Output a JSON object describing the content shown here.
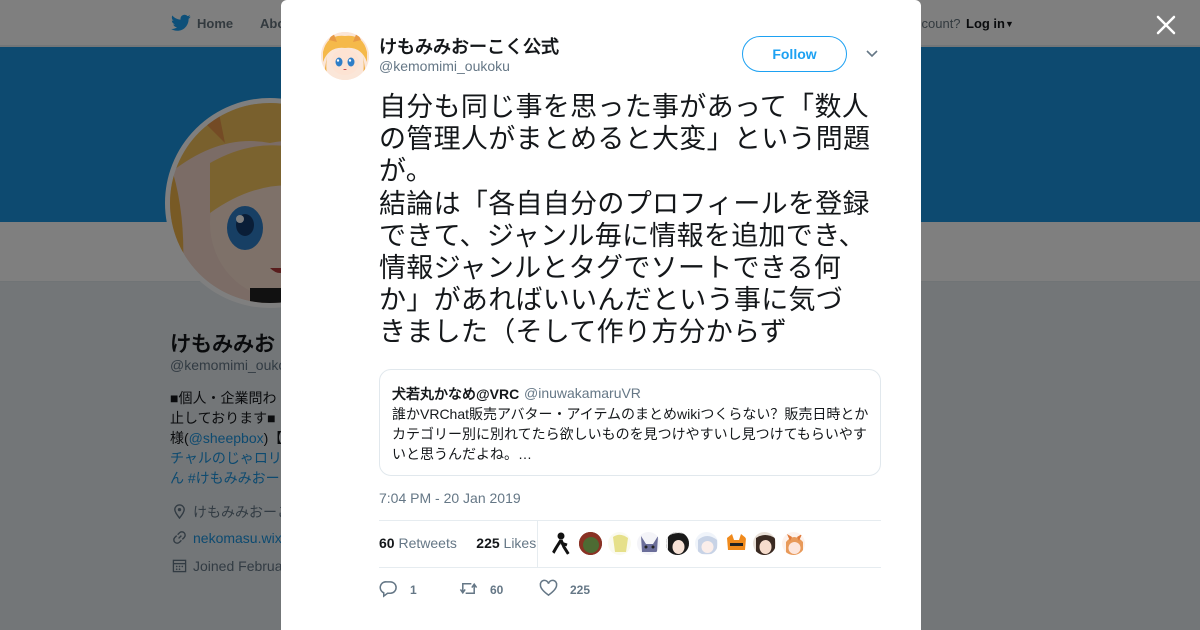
{
  "nav": {
    "home_label": "Home",
    "about_label": "Abo",
    "account_prompt": "ccount?",
    "login_label": "Log in"
  },
  "background_profile": {
    "display_name": "けもみみお",
    "handle": "@kemomimi_oukok",
    "bio_line1": "■個人・企業問わ",
    "bio_line2": "止しております■",
    "bio_line3_prefix": "様(",
    "bio_mention": "@sheepbox",
    "bio_line3_suffix": ")【",
    "bio_line4": "チャルのじゃロリ",
    "bio_line5": "ん #けもみみおー",
    "location": "けもみみおーこ",
    "website": "nekomasu.wix",
    "joined": "Joined Februa"
  },
  "tweet": {
    "author_name": "けもみみおーこく公式",
    "author_handle": "@kemomimi_oukoku",
    "follow_label": "Follow",
    "text": "自分も同じ事を思った事があって「数人\nの管理人がまとめると大変」という問題\nが。\n結論は「各自自分のプロフィールを登録\nできて、ジャンル毎に情報を追加でき、\n情報ジャンルとタグでソートできる何\nか」があればいいんだという事に気づ\nきました（そして作り方分からず",
    "timestamp": "7:04 PM - 20 Jan 2019",
    "retweet_count": "60",
    "retweets_label": "Retweets",
    "like_count": "225",
    "likes_label": "Likes",
    "reply_action_count": "1",
    "retweet_action_count": "60",
    "like_action_count": "225"
  },
  "quoted_tweet": {
    "author_name": "犬若丸かなめ@VRC",
    "author_handle": "@inuwakamaruVR",
    "text": "誰かVRChat販売アバター・アイテムのまとめwikiつくらない？販売日時とかカテゴリー別に別れてたら欲しいものを見つけやすいし見つけてもらいやすいと思うんだよね。…"
  },
  "colors": {
    "accent": "#1da1f2",
    "banner": "#1b95e0",
    "text_primary": "#14171a",
    "text_secondary": "#657786"
  },
  "icons": [
    "twitter-bird-icon",
    "close-icon",
    "chevron-down-icon",
    "location-icon",
    "link-icon",
    "calendar-icon",
    "reply-icon",
    "retweet-icon",
    "heart-icon"
  ]
}
